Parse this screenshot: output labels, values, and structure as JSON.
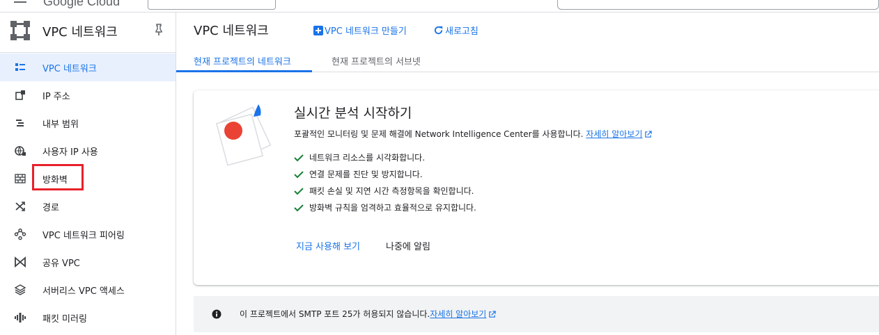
{
  "topbar": {
    "logo": "Google Cloud"
  },
  "sidebar": {
    "title": "VPC 네트워크",
    "items": [
      {
        "label": "VPC 네트워크",
        "icon": "vpc-network-icon",
        "active": true
      },
      {
        "label": "IP 주소",
        "icon": "ip-address-icon"
      },
      {
        "label": "내부 범위",
        "icon": "internal-range-icon"
      },
      {
        "label": "사용자 IP 사용",
        "icon": "globe-icon"
      },
      {
        "label": "방화벽",
        "icon": "firewall-icon"
      },
      {
        "label": "경로",
        "icon": "route-icon"
      },
      {
        "label": "VPC 네트워크 피어링",
        "icon": "peering-icon"
      },
      {
        "label": "공유 VPC",
        "icon": "shared-vpc-icon"
      },
      {
        "label": "서버리스 VPC 액세스",
        "icon": "serverless-icon"
      },
      {
        "label": "패킷 미러링",
        "icon": "packet-mirroring-icon"
      }
    ]
  },
  "header": {
    "title": "VPC 네트워크",
    "create_label": "VPC 네트워크 만들기",
    "refresh_label": "새로고침"
  },
  "tabs": [
    {
      "label": "현재 프로젝트의 네트워크",
      "active": true
    },
    {
      "label": "현재 프로젝트의 서브넷"
    }
  ],
  "card": {
    "heading": "실시간 분석 시작하기",
    "description": "포괄적인 모니터링 및 문제 해결에 Network Intelligence Center를 사용합니다.",
    "learn_more": "자세히 알아보기",
    "checks": [
      "네트워크 리소스를 시각화합니다.",
      "연결 문제를 진단 및 방지합니다.",
      "패킷 손실 및 지연 시간 측정항목을 확인합니다.",
      "방화벽 규칙을 엄격하고 효율적으로 유지합니다."
    ],
    "primary_button": "지금 사용해 보기",
    "secondary_button": "나중에 알림"
  },
  "banner": {
    "message": "이 프로젝트에서 SMTP 포트 25가 허용되지 않습니다.",
    "learn_more": "자세히 알아보기"
  },
  "colors": {
    "accent": "#1a73e8",
    "check": "#188038",
    "highlight": "#e8202a"
  }
}
